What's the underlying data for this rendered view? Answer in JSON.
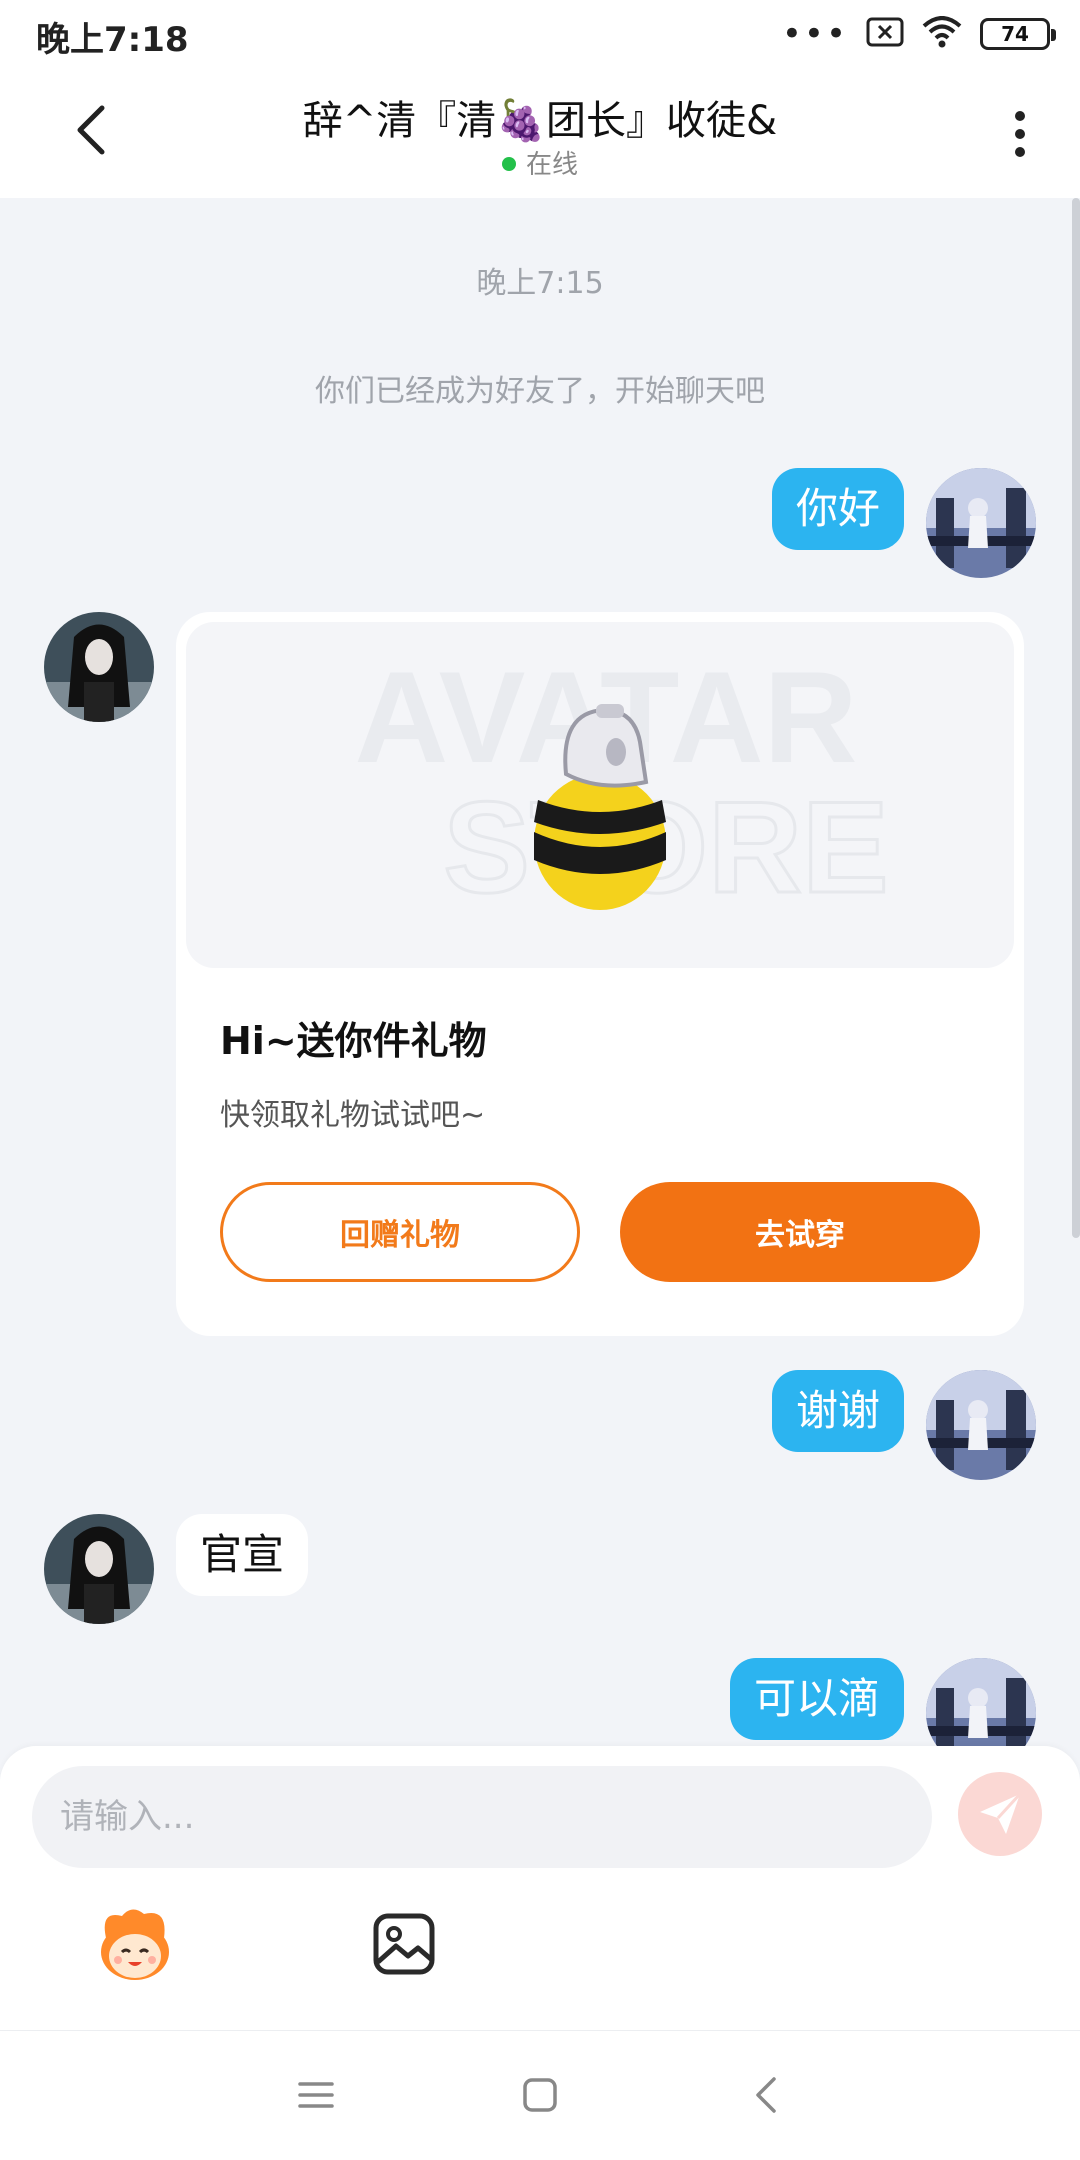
{
  "status_bar": {
    "time": "晚上7:18",
    "signal_dots": "•••",
    "battery": "74"
  },
  "header": {
    "title": "辞^清『清🍇团长』收徒&",
    "status": "在线"
  },
  "chat": {
    "timestamp": "晚上7:15",
    "system_message": "你们已经成为好友了，开始聊天吧",
    "messages": [
      {
        "from": "me",
        "text": "你好"
      },
      {
        "from": "them",
        "type": "gift_card"
      },
      {
        "from": "me",
        "text": "谢谢"
      },
      {
        "from": "them",
        "text": "官宣"
      },
      {
        "from": "me",
        "text": "可以滴"
      }
    ],
    "gift_card": {
      "watermark_line1": "AVATAR",
      "watermark_line2": "STORE",
      "title": "Hi~送你件礼物",
      "subtitle": "快领取礼物试试吧~",
      "return_gift_label": "回赠礼物",
      "try_on_label": "去试穿"
    }
  },
  "composer": {
    "placeholder": "请输入..."
  },
  "colors": {
    "accent_blue": "#2cb4f0",
    "accent_orange": "#f27213",
    "online_green": "#23c04a",
    "send_disabled": "#fbd8d4"
  },
  "icons": [
    "back-arrow-icon",
    "more-vertical-icon",
    "wifi-icon",
    "sim-icon",
    "send-icon",
    "emoji-mascot-icon",
    "image-icon",
    "menu-icon",
    "home-square-icon",
    "back-triangle-icon"
  ]
}
